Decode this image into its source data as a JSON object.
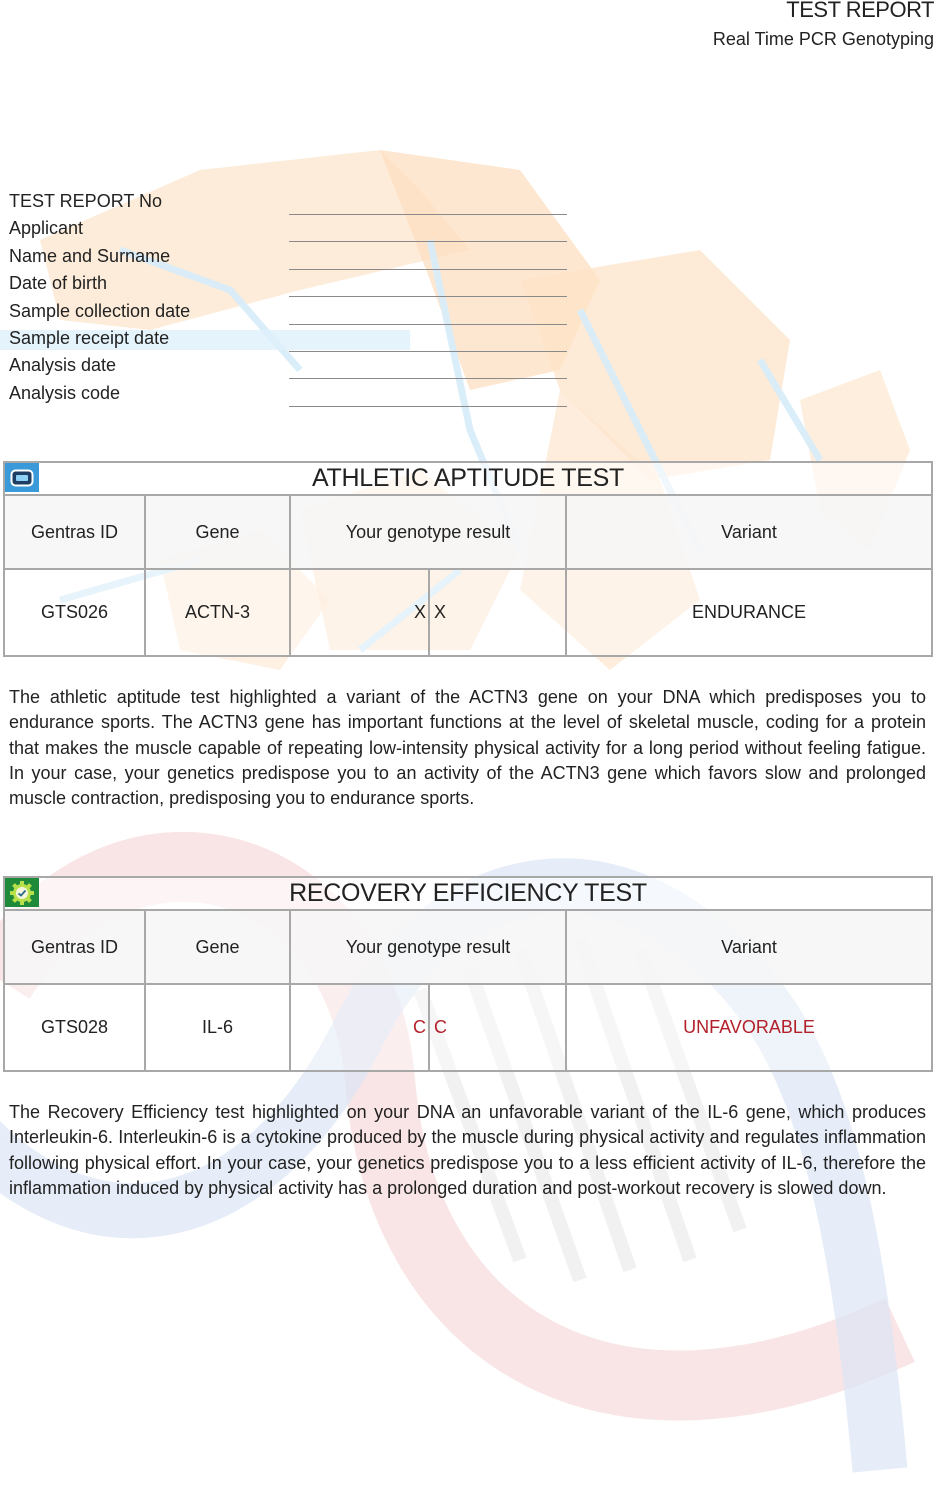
{
  "header": {
    "title": "TEST REPORT",
    "subtitle": "Real Time PCR Genotyping"
  },
  "fields": [
    {
      "label": "TEST REPORT  No",
      "value": ""
    },
    {
      "label": "Applicant",
      "value": ""
    },
    {
      "label": "Name and Surname",
      "value": ""
    },
    {
      "label": "Date of birth",
      "value": ""
    },
    {
      "label": "Sample collection date",
      "value": ""
    },
    {
      "label": "Sample receipt date",
      "value": ""
    },
    {
      "label": "Analysis date",
      "value": ""
    },
    {
      "label": "Analysis code",
      "value": ""
    }
  ],
  "colors": {
    "athletic_icon_bg": "#3a9ad9",
    "recovery_icon_bg": "#1f8a3a",
    "unfavorable_text": "#b3202a",
    "border": "#a8a8a8"
  },
  "sections": [
    {
      "icon": "card-icon",
      "title": "ATHLETIC APTITUDE TEST",
      "columns": [
        "Gentras ID",
        "Gene",
        "Your genotype result",
        "Variant"
      ],
      "row": {
        "id": "GTS026",
        "gene": "ACTN-3",
        "allele1": "X",
        "allele2": "X",
        "variant": "ENDURANCE"
      },
      "description": "The athletic aptitude test highlighted a variant of the ACTN3 gene on your DNA which predisposes you to endurance sports. The ACTN3 gene has important functions at the level of skeletal muscle, coding for a protein that makes the muscle capable of repeating low-intensity physical activity for a long period without feeling fatigue. In your case, your genetics predispose you to an activity of the ACTN3 gene which favors slow and prolonged muscle contraction, predisposing you to endurance sports."
    },
    {
      "icon": "gear-check-icon",
      "title": "RECOVERY EFFICIENCY TEST",
      "columns": [
        "Gentras ID",
        "Gene",
        "Your genotype result",
        "Variant"
      ],
      "row": {
        "id": "GTS028",
        "gene": "IL-6",
        "allele1": "C",
        "allele2": "C",
        "variant": "UNFAVORABLE"
      },
      "description": "The Recovery Efficiency test highlighted on your DNA an unfavorable variant of the IL-6 gene, which produces Interleukin-6. Interleukin-6 is a cytokine produced by the muscle during physical activity and regulates inflammation following physical effort. In your case, your genetics predispose you to a less efficient activity of IL-6, therefore the inflammation induced by physical activity has a prolonged duration and post-workout recovery is slowed down."
    }
  ]
}
